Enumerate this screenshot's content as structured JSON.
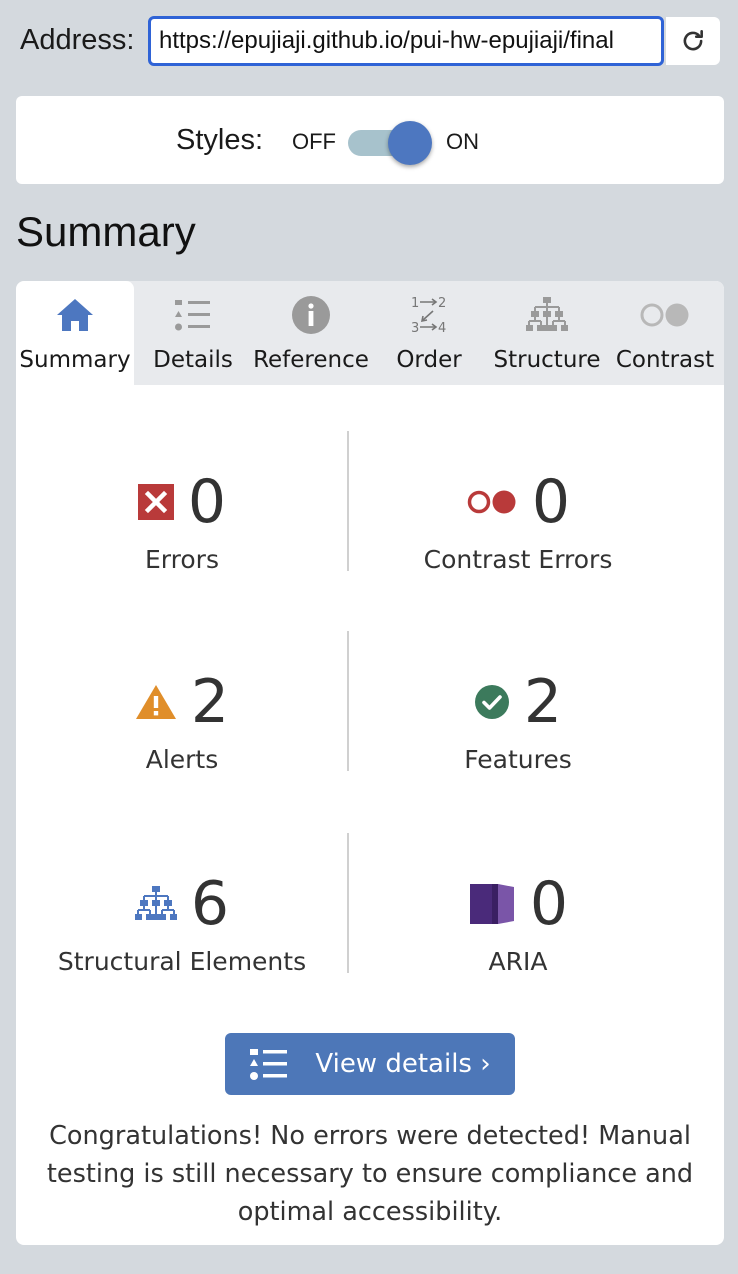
{
  "address": {
    "label": "Address:",
    "url": "https://epujiaji.github.io/pui-hw-epujiaji/final"
  },
  "styles_toggle": {
    "label": "Styles:",
    "off_label": "OFF",
    "on_label": "ON",
    "state": "on"
  },
  "heading": "Summary",
  "tabs": [
    {
      "label": "Summary",
      "icon": "home-icon",
      "active": true
    },
    {
      "label": "Details",
      "icon": "list-icon",
      "active": false
    },
    {
      "label": "Reference",
      "icon": "info-icon",
      "active": false
    },
    {
      "label": "Order",
      "icon": "order-icon",
      "active": false
    },
    {
      "label": "Structure",
      "icon": "hierarchy-icon",
      "active": false
    },
    {
      "label": "Contrast",
      "icon": "contrast-icon",
      "active": false
    }
  ],
  "summary": {
    "errors": {
      "count": "0",
      "label": "Errors",
      "icon": "error-x-icon"
    },
    "contrast_errors": {
      "count": "0",
      "label": "Contrast Errors",
      "icon": "contrast-error-icon"
    },
    "alerts": {
      "count": "2",
      "label": "Alerts",
      "icon": "alert-triangle-icon"
    },
    "features": {
      "count": "2",
      "label": "Features",
      "icon": "feature-check-icon"
    },
    "structural": {
      "count": "6",
      "label": "Structural Elements",
      "icon": "structure-icon"
    },
    "aria": {
      "count": "0",
      "label": "ARIA",
      "icon": "aria-icon"
    }
  },
  "view_details": {
    "label": "View details ›"
  },
  "message": "Congratulations! No errors were detected! Manual testing is still necessary to ensure compliance and optimal accessibility.",
  "colors": {
    "accent": "#4d77b8",
    "error": "#b93a3a",
    "alert": "#e08e2a",
    "feature": "#3c7a5c",
    "aria": "#4a2a7a"
  }
}
